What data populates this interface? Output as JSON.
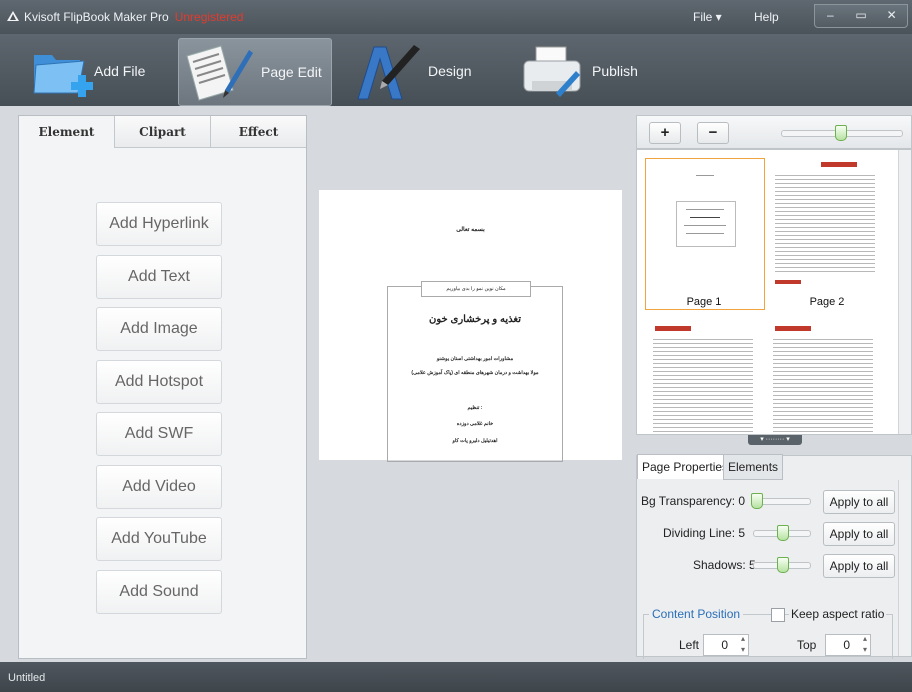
{
  "app": {
    "title": "Kvisoft FlipBook Maker Pro",
    "unregistered": "Unregistered",
    "menu": {
      "file": "File ▾",
      "help": "Help"
    },
    "window_buttons": {
      "minimize": "‒",
      "maximize": "▭",
      "close": "✕"
    }
  },
  "toolbar": {
    "add_file": "Add File",
    "page_edit": "Page Edit",
    "design": "Design",
    "publish": "Publish"
  },
  "left_panel": {
    "tabs": [
      "Element",
      "Clipart",
      "Effect"
    ],
    "buttons": [
      "Add Hyperlink",
      "Add Text",
      "Add Image",
      "Add Hotspot",
      "Add SWF",
      "Add Video",
      "Add YouTube",
      "Add Sound"
    ]
  },
  "canvas": {
    "top_text": "بسمه تعالی",
    "tab_text": "مکان نوین نمو را بدی بیاوریم",
    "title": "تغذیه و پرخشاری خون",
    "line1": "مشاورات امور بهداشتی استان یوشنو",
    "line2": "مولا بهداشت و درمان شهرهای منطقه ای (پاک آموزش علامی)",
    "line3": "تنظیم :",
    "line4": "خانم غلامی دوزده",
    "line5": "اهدتیلیل دلیرو پات کاو"
  },
  "right_panel": {
    "zoom_in": "+",
    "zoom_out": "−",
    "zoom_level": 0.5,
    "thumbnails": [
      "Page 1",
      "Page 2"
    ],
    "splitter": "▾ ········ ▾",
    "props_tabs": [
      "Page Properties",
      "Elements"
    ],
    "bg_transparency_label": "Bg Transparency:",
    "bg_transparency_value": "0",
    "dividing_line_label": "Dividing Line:",
    "dividing_line_value": "5",
    "shadows_label": "Shadows:",
    "shadows_value": "5",
    "apply_to_all": "Apply to all",
    "content_position": "Content Position",
    "keep_aspect": "Keep aspect ratio",
    "left_label": "Left",
    "left_value": "0",
    "top_label": "Top",
    "top_value": "0"
  },
  "status": {
    "text": "Untitled"
  }
}
